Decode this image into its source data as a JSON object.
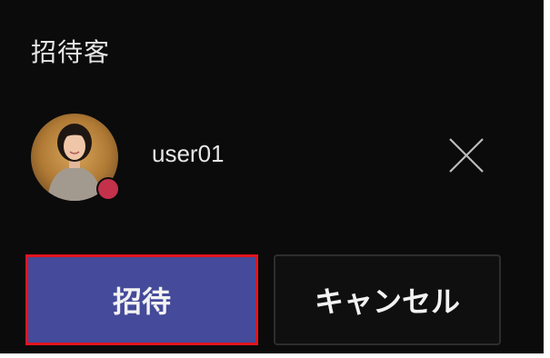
{
  "dialog": {
    "title": "招待客"
  },
  "guest": {
    "name": "user01",
    "avatar_icon": "user-photo-avatar",
    "status_icon": "busy-status-dot",
    "status_color": "#c4314b",
    "remove_icon": "close-icon"
  },
  "actions": {
    "invite_label": "招待",
    "cancel_label": "キャンセル",
    "invite_color": "#454a9a",
    "highlight_color": "#e0141e"
  }
}
